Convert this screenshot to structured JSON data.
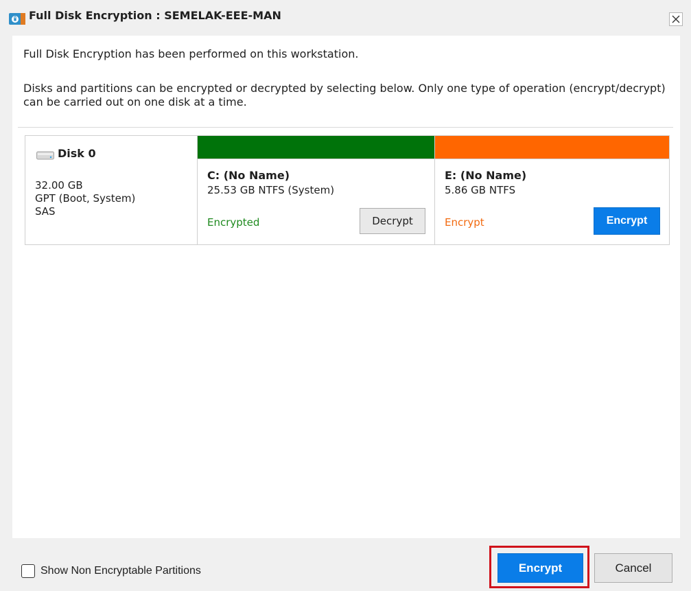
{
  "window": {
    "title": "Full Disk Encryption : SEMELAK-EEE-MAN",
    "icon": "lock-app-icon",
    "close_icon": "close-icon"
  },
  "content": {
    "intro": "Full Disk Encryption has been performed on this workstation.",
    "info": "Disks and partitions can be encrypted or decrypted by selecting below. Only one type of operation (encrypt/decrypt) can be carried out on one disk at a time."
  },
  "disk": {
    "name": "Disk 0",
    "icon": "hard-drive-icon",
    "size": "32.00 GB",
    "partition_style": "GPT (Boot, System)",
    "bus": "SAS"
  },
  "partitions": [
    {
      "name": "C: (No Name)",
      "size": "25.53 GB NTFS (System)",
      "status": "Encrypted",
      "action_label": "Decrypt",
      "bar_color": "#00730a",
      "status_color": "#1f8a1f"
    },
    {
      "name": "E: (No Name)",
      "size": "5.86 GB NTFS",
      "status": "Encrypt",
      "action_label": "Encrypt",
      "bar_color": "#ff6600",
      "status_color": "#f26a10"
    }
  ],
  "footer": {
    "checkbox_label": "Show Non Encryptable Partitions",
    "checkbox_checked": false,
    "primary_label": "Encrypt",
    "cancel_label": "Cancel"
  },
  "colors": {
    "accent": "#0a7de8",
    "highlight": "#d0121b"
  }
}
